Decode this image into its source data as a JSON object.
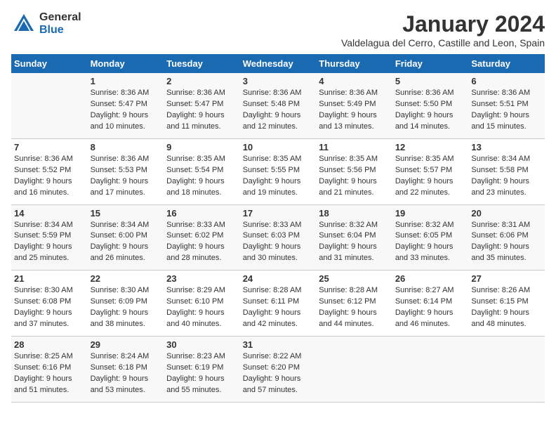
{
  "logo": {
    "general": "General",
    "blue": "Blue"
  },
  "title": "January 2024",
  "location": "Valdelagua del Cerro, Castille and Leon, Spain",
  "days_of_week": [
    "Sunday",
    "Monday",
    "Tuesday",
    "Wednesday",
    "Thursday",
    "Friday",
    "Saturday"
  ],
  "weeks": [
    [
      {
        "day": "",
        "info": ""
      },
      {
        "day": "1",
        "info": "Sunrise: 8:36 AM\nSunset: 5:47 PM\nDaylight: 9 hours\nand 10 minutes."
      },
      {
        "day": "2",
        "info": "Sunrise: 8:36 AM\nSunset: 5:47 PM\nDaylight: 9 hours\nand 11 minutes."
      },
      {
        "day": "3",
        "info": "Sunrise: 8:36 AM\nSunset: 5:48 PM\nDaylight: 9 hours\nand 12 minutes."
      },
      {
        "day": "4",
        "info": "Sunrise: 8:36 AM\nSunset: 5:49 PM\nDaylight: 9 hours\nand 13 minutes."
      },
      {
        "day": "5",
        "info": "Sunrise: 8:36 AM\nSunset: 5:50 PM\nDaylight: 9 hours\nand 14 minutes."
      },
      {
        "day": "6",
        "info": "Sunrise: 8:36 AM\nSunset: 5:51 PM\nDaylight: 9 hours\nand 15 minutes."
      }
    ],
    [
      {
        "day": "7",
        "info": "Sunrise: 8:36 AM\nSunset: 5:52 PM\nDaylight: 9 hours\nand 16 minutes."
      },
      {
        "day": "8",
        "info": "Sunrise: 8:36 AM\nSunset: 5:53 PM\nDaylight: 9 hours\nand 17 minutes."
      },
      {
        "day": "9",
        "info": "Sunrise: 8:35 AM\nSunset: 5:54 PM\nDaylight: 9 hours\nand 18 minutes."
      },
      {
        "day": "10",
        "info": "Sunrise: 8:35 AM\nSunset: 5:55 PM\nDaylight: 9 hours\nand 19 minutes."
      },
      {
        "day": "11",
        "info": "Sunrise: 8:35 AM\nSunset: 5:56 PM\nDaylight: 9 hours\nand 21 minutes."
      },
      {
        "day": "12",
        "info": "Sunrise: 8:35 AM\nSunset: 5:57 PM\nDaylight: 9 hours\nand 22 minutes."
      },
      {
        "day": "13",
        "info": "Sunrise: 8:34 AM\nSunset: 5:58 PM\nDaylight: 9 hours\nand 23 minutes."
      }
    ],
    [
      {
        "day": "14",
        "info": "Sunrise: 8:34 AM\nSunset: 5:59 PM\nDaylight: 9 hours\nand 25 minutes."
      },
      {
        "day": "15",
        "info": "Sunrise: 8:34 AM\nSunset: 6:00 PM\nDaylight: 9 hours\nand 26 minutes."
      },
      {
        "day": "16",
        "info": "Sunrise: 8:33 AM\nSunset: 6:02 PM\nDaylight: 9 hours\nand 28 minutes."
      },
      {
        "day": "17",
        "info": "Sunrise: 8:33 AM\nSunset: 6:03 PM\nDaylight: 9 hours\nand 30 minutes."
      },
      {
        "day": "18",
        "info": "Sunrise: 8:32 AM\nSunset: 6:04 PM\nDaylight: 9 hours\nand 31 minutes."
      },
      {
        "day": "19",
        "info": "Sunrise: 8:32 AM\nSunset: 6:05 PM\nDaylight: 9 hours\nand 33 minutes."
      },
      {
        "day": "20",
        "info": "Sunrise: 8:31 AM\nSunset: 6:06 PM\nDaylight: 9 hours\nand 35 minutes."
      }
    ],
    [
      {
        "day": "21",
        "info": "Sunrise: 8:30 AM\nSunset: 6:08 PM\nDaylight: 9 hours\nand 37 minutes."
      },
      {
        "day": "22",
        "info": "Sunrise: 8:30 AM\nSunset: 6:09 PM\nDaylight: 9 hours\nand 38 minutes."
      },
      {
        "day": "23",
        "info": "Sunrise: 8:29 AM\nSunset: 6:10 PM\nDaylight: 9 hours\nand 40 minutes."
      },
      {
        "day": "24",
        "info": "Sunrise: 8:28 AM\nSunset: 6:11 PM\nDaylight: 9 hours\nand 42 minutes."
      },
      {
        "day": "25",
        "info": "Sunrise: 8:28 AM\nSunset: 6:12 PM\nDaylight: 9 hours\nand 44 minutes."
      },
      {
        "day": "26",
        "info": "Sunrise: 8:27 AM\nSunset: 6:14 PM\nDaylight: 9 hours\nand 46 minutes."
      },
      {
        "day": "27",
        "info": "Sunrise: 8:26 AM\nSunset: 6:15 PM\nDaylight: 9 hours\nand 48 minutes."
      }
    ],
    [
      {
        "day": "28",
        "info": "Sunrise: 8:25 AM\nSunset: 6:16 PM\nDaylight: 9 hours\nand 51 minutes."
      },
      {
        "day": "29",
        "info": "Sunrise: 8:24 AM\nSunset: 6:18 PM\nDaylight: 9 hours\nand 53 minutes."
      },
      {
        "day": "30",
        "info": "Sunrise: 8:23 AM\nSunset: 6:19 PM\nDaylight: 9 hours\nand 55 minutes."
      },
      {
        "day": "31",
        "info": "Sunrise: 8:22 AM\nSunset: 6:20 PM\nDaylight: 9 hours\nand 57 minutes."
      },
      {
        "day": "",
        "info": ""
      },
      {
        "day": "",
        "info": ""
      },
      {
        "day": "",
        "info": ""
      }
    ]
  ]
}
